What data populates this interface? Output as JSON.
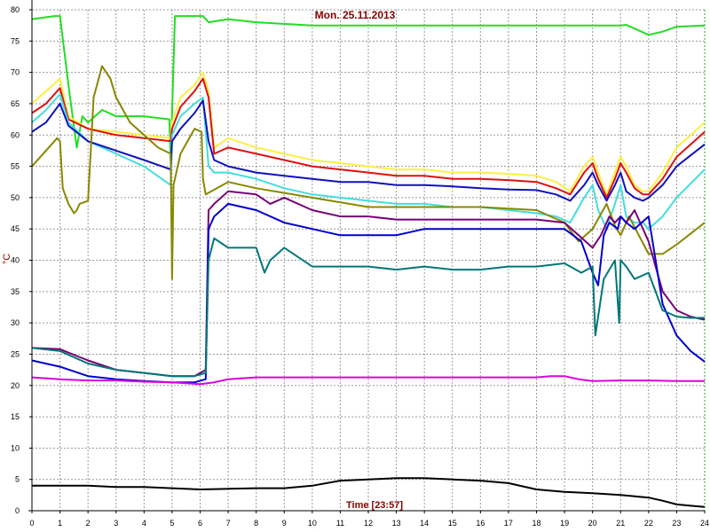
{
  "chart_data": {
    "type": "line",
    "title": "Mon. 25.11.2013",
    "xlabel": "Time [23:57]",
    "ylabel": "°C",
    "xlim": [
      0,
      24
    ],
    "ylim": [
      0,
      80
    ],
    "x_ticks": [
      0,
      1,
      2,
      3,
      4,
      5,
      6,
      7,
      8,
      9,
      10,
      11,
      12,
      13,
      14,
      15,
      16,
      17,
      18,
      19,
      20,
      21,
      22,
      23,
      24
    ],
    "y_ticks": [
      0,
      5,
      10,
      15,
      20,
      25,
      30,
      35,
      40,
      45,
      50,
      55,
      60,
      65,
      70,
      75,
      80
    ],
    "grid": true,
    "series": [
      {
        "color": "#22dd22",
        "x": [
          0,
          0.8,
          1.0,
          1.3,
          1.6,
          1.8,
          2.0,
          2.5,
          3.0,
          4.0,
          4.9,
          4.95,
          5.1,
          5.5,
          6.0,
          6.1,
          6.3,
          7,
          8,
          10,
          12,
          14,
          16,
          18,
          19,
          20,
          21,
          21.2,
          21.5,
          22,
          22.5,
          23,
          24
        ],
        "y": [
          78.5,
          79,
          79,
          68,
          58,
          63,
          62,
          64,
          63,
          63,
          62.5,
          56,
          79,
          79,
          79,
          79,
          78,
          78.5,
          78,
          77.5,
          77.5,
          77.5,
          77.5,
          77.5,
          77.5,
          77.5,
          77.5,
          77.6,
          77,
          76,
          76.5,
          77.3,
          77.5
        ]
      },
      {
        "color": "#ffee44",
        "x": [
          0,
          0.5,
          1.0,
          1.3,
          2,
          3,
          4,
          4.95,
          5.0,
          5.3,
          5.8,
          6.1,
          6.3,
          6.5,
          7,
          8,
          9,
          10,
          11,
          12,
          13,
          14,
          15,
          16,
          17,
          18,
          18.7,
          19.2,
          19.7,
          20,
          20.2,
          20.5,
          20.8,
          21,
          21.2,
          21.5,
          21.8,
          22,
          22.5,
          23,
          24
        ],
        "y": [
          65,
          67,
          69,
          63,
          61,
          60.5,
          60,
          59.5,
          62,
          66,
          68,
          70,
          67,
          58,
          59.5,
          58,
          57,
          56,
          55.5,
          55,
          54.5,
          54.5,
          54,
          54,
          53.8,
          53.5,
          52.5,
          51,
          55,
          56.5,
          54,
          50.5,
          54,
          56.5,
          55,
          52,
          51,
          51,
          54,
          58,
          62
        ]
      },
      {
        "color": "#dd1111",
        "x": [
          0,
          0.5,
          1.0,
          1.3,
          2,
          3,
          4,
          4.95,
          5.0,
          5.3,
          5.8,
          6.1,
          6.3,
          6.5,
          7,
          8,
          9,
          10,
          11,
          12,
          13,
          14,
          15,
          16,
          17,
          18,
          18.7,
          19.2,
          19.7,
          20,
          20.2,
          20.5,
          20.8,
          21,
          21.2,
          21.5,
          21.8,
          22,
          22.5,
          23,
          24
        ],
        "y": [
          63.5,
          65,
          67.5,
          62.5,
          61,
          60,
          59.5,
          59,
          61,
          64.5,
          67,
          69,
          66,
          57,
          58,
          57,
          56,
          55,
          54.5,
          54,
          53.5,
          53.5,
          53,
          53,
          52.8,
          52.5,
          51.5,
          50.5,
          54,
          55.5,
          53,
          50,
          53,
          55.5,
          54,
          51.5,
          50.5,
          50.5,
          53,
          56.5,
          60.5
        ]
      },
      {
        "color": "#44dddd",
        "x": [
          0,
          0.5,
          1.0,
          1.3,
          2,
          3,
          4,
          4.95,
          5.0,
          5.3,
          5.8,
          6.1,
          6.3,
          6.5,
          7,
          8,
          9,
          10,
          11,
          12,
          13,
          14,
          15,
          16,
          17,
          18,
          18.7,
          19.2,
          19.7,
          20,
          20.2,
          20.5,
          20.8,
          21,
          21.2,
          21.5,
          21.8,
          22,
          22.5,
          23,
          24
        ],
        "y": [
          62,
          64,
          66.5,
          62,
          59,
          57,
          55,
          52,
          60,
          63,
          65,
          66,
          55,
          54,
          54,
          53,
          51.5,
          50.5,
          50,
          49.5,
          49,
          49,
          48.5,
          48.5,
          48,
          47.5,
          47,
          46,
          50,
          52,
          48,
          45,
          49,
          52,
          47,
          46,
          46,
          45,
          47,
          50,
          54.5
        ]
      },
      {
        "color": "#1111bb",
        "x": [
          0,
          0.5,
          1.0,
          1.3,
          2,
          3,
          4,
          4.95,
          5.0,
          5.3,
          5.8,
          6.1,
          6.3,
          6.5,
          7,
          8,
          9,
          10,
          11,
          12,
          13,
          14,
          15,
          16,
          17,
          18,
          18.7,
          19.2,
          19.7,
          20,
          20.2,
          20.5,
          20.8,
          21,
          21.2,
          21.5,
          21.8,
          22,
          22.5,
          23,
          24
        ],
        "y": [
          60.5,
          62,
          65,
          61.5,
          59,
          57.5,
          56,
          54.5,
          59,
          61,
          63.5,
          65.5,
          59,
          56,
          55,
          54,
          53.5,
          53,
          52.5,
          52.5,
          52,
          52,
          51.8,
          51.5,
          51.3,
          51.2,
          50.5,
          49.5,
          52,
          54,
          52,
          49.5,
          52,
          54,
          51,
          50,
          49.5,
          50,
          52,
          55,
          58.5
        ]
      },
      {
        "color": "#888800",
        "x": [
          0,
          0.9,
          1.0,
          1.1,
          1.3,
          1.5,
          1.6,
          1.7,
          2.0,
          2.2,
          2.5,
          2.8,
          3.0,
          3.5,
          4.0,
          4.5,
          4.95,
          5.0,
          5.05,
          5.3,
          5.8,
          6.05,
          6.1,
          6.2,
          6.4,
          7,
          8,
          10,
          12,
          14,
          16,
          18,
          19.0,
          19.5,
          20,
          20.5,
          20.8,
          21,
          21.3,
          22,
          22.5,
          23,
          24
        ],
        "y": [
          55,
          59.5,
          59,
          51.5,
          49,
          47.5,
          48,
          49,
          49.5,
          66,
          71,
          69,
          66,
          62,
          60,
          58,
          57,
          37,
          52,
          57,
          61,
          60.5,
          53,
          50.5,
          51,
          52.5,
          51.5,
          50,
          48.5,
          48.5,
          48.5,
          48,
          46,
          43,
          45,
          49,
          45.5,
          44,
          47,
          41,
          41,
          42.5,
          46
        ]
      },
      {
        "color": "#770077",
        "x": [
          0,
          1,
          2,
          3,
          4,
          5,
          5.8,
          6.2,
          6.3,
          6.5,
          7,
          8,
          8.5,
          9,
          10,
          11,
          12,
          13,
          14,
          15,
          16,
          17,
          18,
          19,
          19.5,
          20,
          20.3,
          20.6,
          20.8,
          21,
          21.2,
          21.5,
          22,
          22.5,
          23,
          23.5,
          24
        ],
        "y": [
          26,
          25.8,
          24,
          22.5,
          22,
          21.5,
          21.5,
          22.5,
          48,
          49,
          51,
          50.5,
          49,
          50,
          48,
          47,
          47,
          46.5,
          46.5,
          46.5,
          46.5,
          46.5,
          46.5,
          46,
          44,
          42,
          44,
          47,
          46,
          47,
          46,
          48,
          43,
          35,
          32,
          31,
          30.5
        ]
      },
      {
        "color": "#0000cc",
        "x": [
          0,
          1,
          2,
          3,
          4,
          5,
          5.8,
          6.2,
          6.3,
          6.5,
          7,
          8,
          9,
          10,
          11,
          12,
          13,
          14,
          15,
          16,
          17,
          18,
          19,
          19.6,
          20,
          20.2,
          20.4,
          20.6,
          20.9,
          21,
          21.2,
          21.5,
          22,
          22.5,
          23,
          23.5,
          24
        ],
        "y": [
          24,
          23,
          21.5,
          21,
          20.7,
          20.5,
          20.5,
          21,
          45,
          47,
          49,
          48,
          46,
          45,
          44,
          44,
          44,
          45,
          45,
          45,
          45,
          45,
          45,
          43,
          38,
          36,
          44,
          46,
          45,
          47,
          46,
          45,
          47,
          33,
          28,
          25.5,
          23.8
        ]
      },
      {
        "color": "#007777",
        "x": [
          0,
          1,
          2,
          3,
          4,
          5,
          5.8,
          6.2,
          6.3,
          6.5,
          7,
          8,
          8.3,
          8.5,
          9,
          10,
          11,
          12,
          13,
          14,
          15,
          16,
          17,
          18,
          19,
          19.6,
          20,
          20.1,
          20.4,
          20.8,
          20.95,
          21,
          21.2,
          21.5,
          22,
          22.5,
          23,
          23.5,
          24
        ],
        "y": [
          26,
          25.5,
          23.5,
          22.5,
          22,
          21.5,
          21.5,
          22,
          40,
          43.5,
          42,
          42,
          38,
          40,
          42,
          39,
          39,
          39,
          38.5,
          39,
          38.5,
          38.5,
          39,
          39,
          39.5,
          38,
          39,
          28,
          37,
          40,
          30,
          40,
          39,
          37,
          38,
          32,
          31,
          30.8,
          30.8
        ]
      },
      {
        "color": "#dd00dd",
        "x": [
          0,
          1,
          2,
          3,
          4,
          5,
          6,
          6.5,
          7,
          8,
          9,
          10,
          12,
          14,
          16,
          18,
          18.5,
          19,
          19.5,
          20,
          21,
          22,
          23,
          24
        ],
        "y": [
          21.3,
          21,
          20.8,
          20.8,
          20.6,
          20.5,
          20.2,
          20.5,
          21,
          21.3,
          21.3,
          21.3,
          21.3,
          21.3,
          21.3,
          21.3,
          21.5,
          21.5,
          21,
          20.7,
          20.8,
          20.8,
          20.7,
          20.7
        ]
      },
      {
        "color": "#000000",
        "x": [
          0,
          1,
          2,
          3,
          4,
          5,
          6,
          7,
          8,
          9,
          10,
          11,
          12,
          13,
          14,
          15,
          16,
          17,
          18,
          19,
          20,
          21,
          22,
          22.5,
          23,
          23.5,
          24
        ],
        "y": [
          4,
          4,
          4,
          3.8,
          3.8,
          3.6,
          3.4,
          3.5,
          3.6,
          3.6,
          4,
          4.8,
          5,
          5.2,
          5.2,
          5,
          4.8,
          4.4,
          3.4,
          3,
          2.8,
          2.5,
          2.1,
          1.6,
          1,
          0.8,
          0.6
        ]
      }
    ]
  }
}
